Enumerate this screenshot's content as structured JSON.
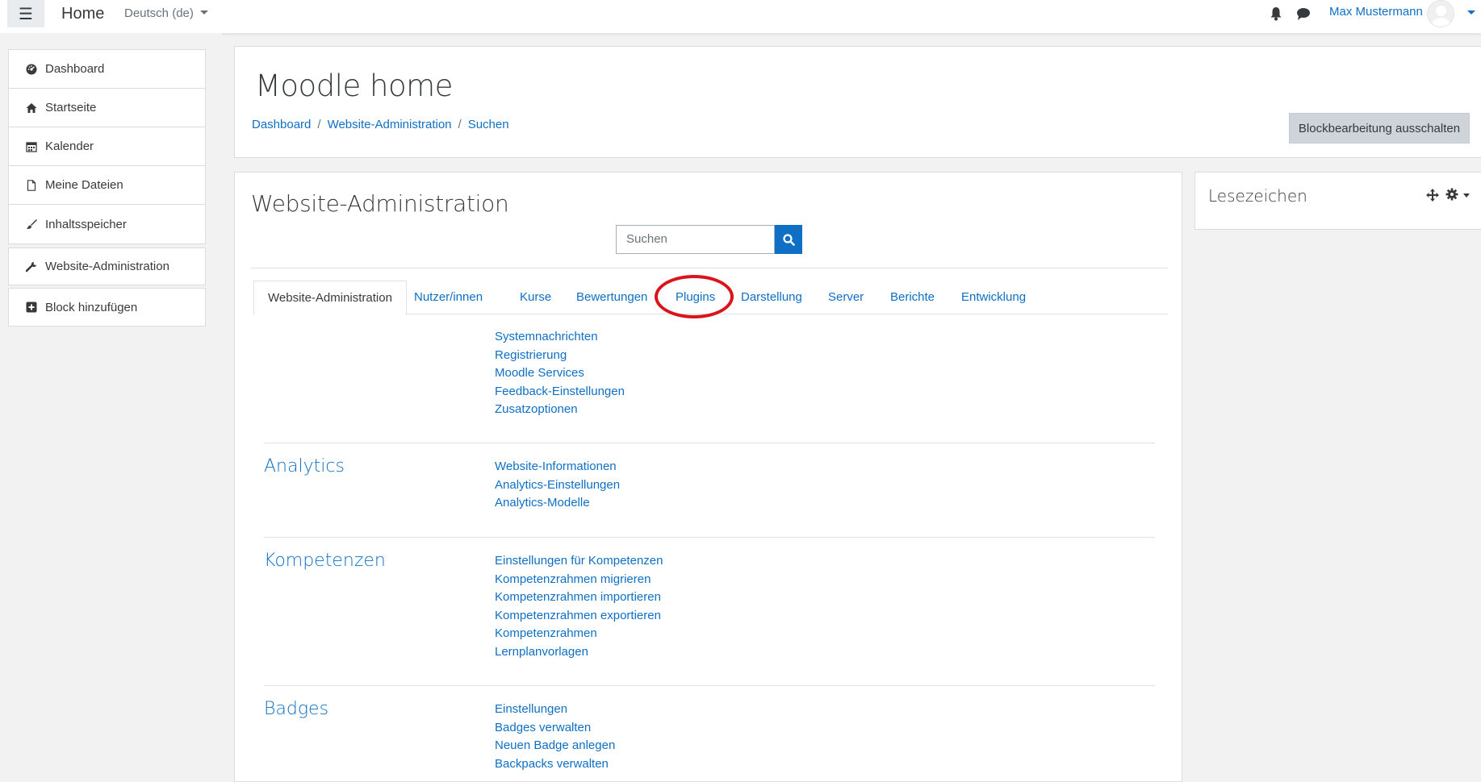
{
  "navbar": {
    "brand": "Home",
    "language": "Deutsch (de)",
    "username": "Max Mustermann",
    "icons": [
      "menu-icon",
      "bell-icon",
      "chat-icon",
      "avatar"
    ]
  },
  "drawer": {
    "main_items": [
      {
        "label": "Dashboard",
        "icon": "dashboard-icon"
      },
      {
        "label": "Startseite",
        "icon": "home-icon"
      },
      {
        "label": "Kalender",
        "icon": "calendar-icon"
      },
      {
        "label": "Meine Dateien",
        "icon": "file-icon"
      },
      {
        "label": "Inhaltsspeicher",
        "icon": "brush-icon"
      }
    ],
    "admin_item": {
      "label": "Website-Administration",
      "icon": "wrench-icon"
    },
    "add_block": {
      "label": "Block hinzufügen",
      "icon": "plus-square-icon"
    }
  },
  "header": {
    "title": "Moodle home",
    "breadcrumb": [
      "Dashboard",
      "Website-Administration",
      "Suchen"
    ],
    "block_button": "Blockbearbeitung ausschalten"
  },
  "admin": {
    "title": "Website-Administration",
    "search_placeholder": "Suchen",
    "tabs": [
      {
        "label": "Website-Administration",
        "active": true
      },
      {
        "label": "Nutzer/innen",
        "active": false
      },
      {
        "label": "Kurse",
        "active": false
      },
      {
        "label": "Bewertungen",
        "active": false
      },
      {
        "label": "Plugins",
        "active": false,
        "highlighted": true
      },
      {
        "label": "Darstellung",
        "active": false
      },
      {
        "label": "Server",
        "active": false
      },
      {
        "label": "Berichte",
        "active": false
      },
      {
        "label": "Entwicklung",
        "active": false
      }
    ],
    "top_links": [
      "Systemnachrichten",
      "Registrierung",
      "Moodle Services",
      "Feedback-Einstellungen",
      "Zusatzoptionen"
    ],
    "categories": [
      {
        "title": "Analytics",
        "links": [
          "Website-Informationen",
          "Analytics-Einstellungen",
          "Analytics-Modelle"
        ]
      },
      {
        "title": "Kompetenzen",
        "links": [
          "Einstellungen für Kompetenzen",
          "Kompetenzrahmen migrieren",
          "Kompetenzrahmen importieren",
          "Kompetenzrahmen exportieren",
          "Kompetenzrahmen",
          "Lernplanvorlagen"
        ]
      },
      {
        "title": "Badges",
        "links": [
          "Einstellungen",
          "Badges verwalten",
          "Neuen Badge anlegen",
          "Backpacks verwalten"
        ]
      }
    ]
  },
  "side_block": {
    "title": "Lesezeichen"
  },
  "colors": {
    "link": "#0f6fc5",
    "highlight_ring": "#d9141b",
    "button_bg": "#ced4da"
  }
}
